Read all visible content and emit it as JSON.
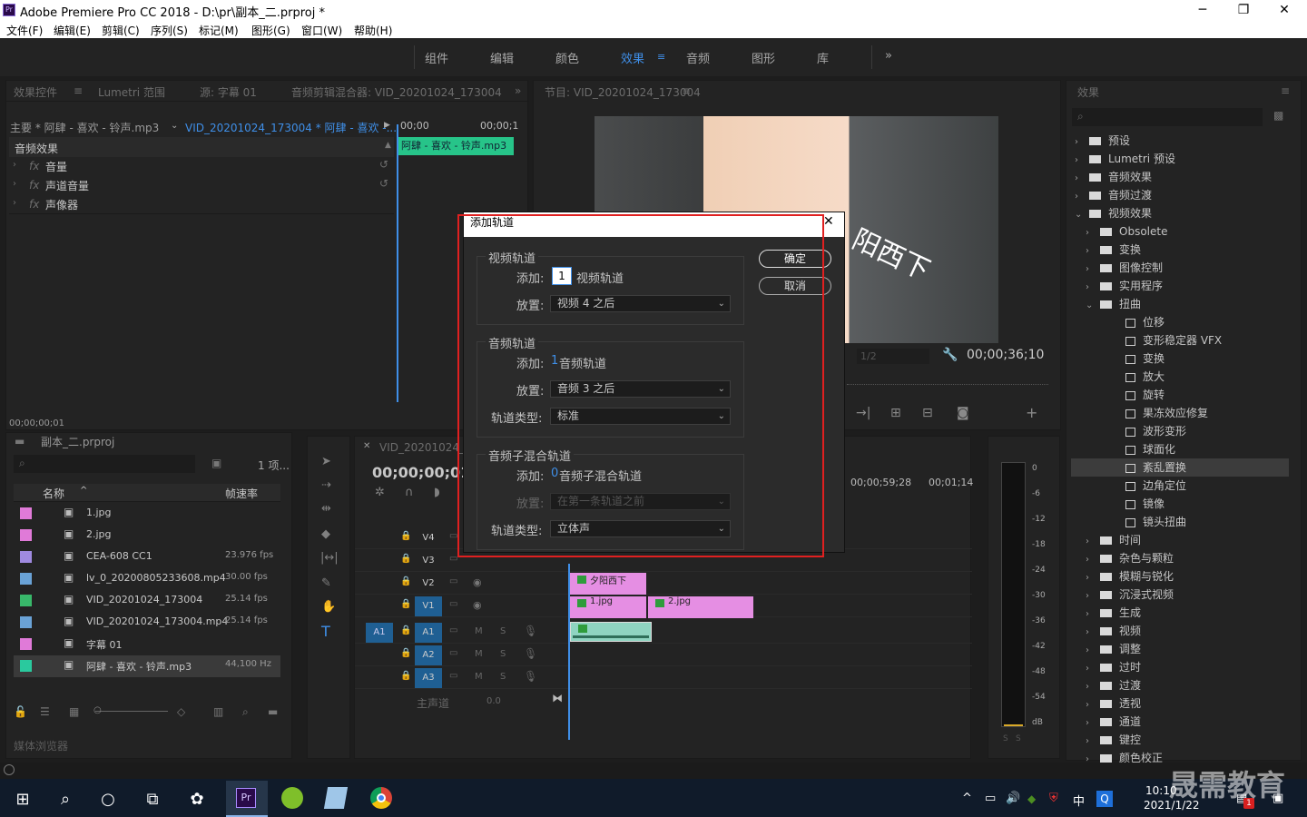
{
  "window": {
    "title": "Adobe Premiere Pro CC 2018 - D:\\pr\\副本_二.prproj *",
    "app_badge": "Pr",
    "min": "─",
    "max": "❐",
    "close": "✕"
  },
  "menu": [
    "文件(F)",
    "编辑(E)",
    "剪辑(C)",
    "序列(S)",
    "标记(M)",
    "图形(G)",
    "窗口(W)",
    "帮助(H)"
  ],
  "workspaces": {
    "items": [
      "组件",
      "编辑",
      "颜色",
      "效果",
      "音频",
      "图形",
      "库"
    ],
    "active": "效果",
    "overflow": "»"
  },
  "effect_controls": {
    "tabs": [
      "效果控件",
      "Lumetri 范围",
      "源: 字幕 01",
      "音频剪辑混合器: VID_20201024_173004"
    ],
    "master": "主要 * 阿肆 - 喜欢 - 铃声.mp3",
    "sequence": "VID_20201024_173004 * 阿肆 - 喜欢 -...",
    "section": "音频效果",
    "rows": [
      "音量",
      "声道音量",
      "声像器"
    ],
    "fx_label": "fx",
    "time_start": "00;00",
    "time_end": "00;00;1",
    "clip": "阿肆 - 喜欢 - 铃声.mp3",
    "timecode": "00;00;00;01"
  },
  "program": {
    "title": "节目: VID_20201024_173004",
    "overlay_text": "阳西下",
    "fraction": "1/2",
    "timecode": "00;00;36;10"
  },
  "project": {
    "name": "副本_二.prproj",
    "count": "1 项...",
    "search_placeholder": "",
    "col_name": "名称",
    "col_fps": "帧速率",
    "items": [
      {
        "name": "1.jpg",
        "fps": "",
        "color": "#e07ad8"
      },
      {
        "name": "2.jpg",
        "fps": "",
        "color": "#e07ad8"
      },
      {
        "name": "CEA-608 CC1",
        "fps": "23.976 fps",
        "color": "#9f8ae0"
      },
      {
        "name": "lv_0_20200805233608.mp4",
        "fps": "30.00 fps",
        "color": "#6aa2d6"
      },
      {
        "name": "VID_20201024_173004",
        "fps": "25.14 fps",
        "color": "#38b86a"
      },
      {
        "name": "VID_20201024_173004.mp4",
        "fps": "25.14 fps",
        "color": "#6aa2d6"
      },
      {
        "name": "字幕 01",
        "fps": "",
        "color": "#e07ad8"
      },
      {
        "name": "阿肆 - 喜欢 - 铃声.mp3",
        "fps": "44,100 Hz",
        "color": "#2ac99e"
      }
    ],
    "media_browser": "媒体浏览器"
  },
  "timeline": {
    "tab": "VID_20201024_17...",
    "timecode": "00;00;00;01",
    "ruler": [
      "00;00;59;28",
      "00;01;14"
    ],
    "tracks": [
      "V4",
      "V3",
      "V2",
      "V1",
      "A1",
      "A2",
      "A3"
    ],
    "master": "主声道",
    "master_val": "0.0",
    "clips": {
      "title": "夕阳西下",
      "c1": "1.jpg",
      "c2": "2.jpg"
    }
  },
  "meter": {
    "labels": [
      "0",
      "-6",
      "-12",
      "-18",
      "-24",
      "-30",
      "-36",
      "-42",
      "-48",
      "-54",
      "dB"
    ],
    "solo": "S"
  },
  "effects": {
    "title": "效果",
    "items": [
      {
        "name": "预设",
        "lvl": 0,
        "type": "folder-star",
        "open": false
      },
      {
        "name": "Lumetri 预设",
        "lvl": 0,
        "type": "folder",
        "open": false
      },
      {
        "name": "音频效果",
        "lvl": 0,
        "type": "folder",
        "open": false
      },
      {
        "name": "音频过渡",
        "lvl": 0,
        "type": "folder",
        "open": false
      },
      {
        "name": "视频效果",
        "lvl": 0,
        "type": "folder",
        "open": true
      },
      {
        "name": "Obsolete",
        "lvl": 1,
        "type": "folder",
        "open": false
      },
      {
        "name": "变换",
        "lvl": 1,
        "type": "folder",
        "open": false
      },
      {
        "name": "图像控制",
        "lvl": 1,
        "type": "folder",
        "open": false
      },
      {
        "name": "实用程序",
        "lvl": 1,
        "type": "folder",
        "open": false
      },
      {
        "name": "扭曲",
        "lvl": 1,
        "type": "folder",
        "open": true
      },
      {
        "name": "位移",
        "lvl": 2,
        "type": "preset"
      },
      {
        "name": "变形稳定器 VFX",
        "lvl": 2,
        "type": "preset"
      },
      {
        "name": "变换",
        "lvl": 2,
        "type": "preset"
      },
      {
        "name": "放大",
        "lvl": 2,
        "type": "preset"
      },
      {
        "name": "旋转",
        "lvl": 2,
        "type": "preset"
      },
      {
        "name": "果冻效应修复",
        "lvl": 2,
        "type": "preset"
      },
      {
        "name": "波形变形",
        "lvl": 2,
        "type": "preset"
      },
      {
        "name": "球面化",
        "lvl": 2,
        "type": "preset"
      },
      {
        "name": "紊乱置换",
        "lvl": 2,
        "type": "preset",
        "selected": true
      },
      {
        "name": "边角定位",
        "lvl": 2,
        "type": "preset"
      },
      {
        "name": "镜像",
        "lvl": 2,
        "type": "preset"
      },
      {
        "name": "镜头扭曲",
        "lvl": 2,
        "type": "preset"
      },
      {
        "name": "时间",
        "lvl": 1,
        "type": "folder",
        "open": false
      },
      {
        "name": "杂色与颗粒",
        "lvl": 1,
        "type": "folder",
        "open": false
      },
      {
        "name": "模糊与锐化",
        "lvl": 1,
        "type": "folder",
        "open": false
      },
      {
        "name": "沉浸式视频",
        "lvl": 1,
        "type": "folder",
        "open": false
      },
      {
        "name": "生成",
        "lvl": 1,
        "type": "folder",
        "open": false
      },
      {
        "name": "视频",
        "lvl": 1,
        "type": "folder",
        "open": false
      },
      {
        "name": "调整",
        "lvl": 1,
        "type": "folder",
        "open": false
      },
      {
        "name": "过时",
        "lvl": 1,
        "type": "folder",
        "open": false
      },
      {
        "name": "过渡",
        "lvl": 1,
        "type": "folder",
        "open": false
      },
      {
        "name": "透视",
        "lvl": 1,
        "type": "folder",
        "open": false
      },
      {
        "name": "通道",
        "lvl": 1,
        "type": "folder",
        "open": false
      },
      {
        "name": "键控",
        "lvl": 1,
        "type": "folder",
        "open": false
      },
      {
        "name": "颜色校正",
        "lvl": 1,
        "type": "folder",
        "open": false
      }
    ]
  },
  "dialog": {
    "title": "添加轨道",
    "close": "✕",
    "ok": "确定",
    "cancel": "取消",
    "video": {
      "label": "视频轨道",
      "add_label": "添加:",
      "add_value": "1",
      "add_unit": "视频轨道",
      "place_label": "放置:",
      "place_value": "视频 4 之后"
    },
    "audio": {
      "label": "音频轨道",
      "add_label": "添加:",
      "add_value": "1",
      "add_unit": "音频轨道",
      "place_label": "放置:",
      "place_value": "音频 3 之后",
      "type_label": "轨道类型:",
      "type_value": "标准"
    },
    "submix": {
      "label": "音频子混合轨道",
      "add_label": "添加:",
      "add_value": "0",
      "add_unit": "音频子混合轨道",
      "place_label": "放置:",
      "place_value": "在第一条轨道之前",
      "type_label": "轨道类型:",
      "type_value": "立体声"
    }
  },
  "taskbar": {
    "time": "10:10",
    "date": "2021/1/22",
    "ime": "中",
    "pr": "Pr",
    "notif": "1"
  },
  "watermark": "晟需教育"
}
